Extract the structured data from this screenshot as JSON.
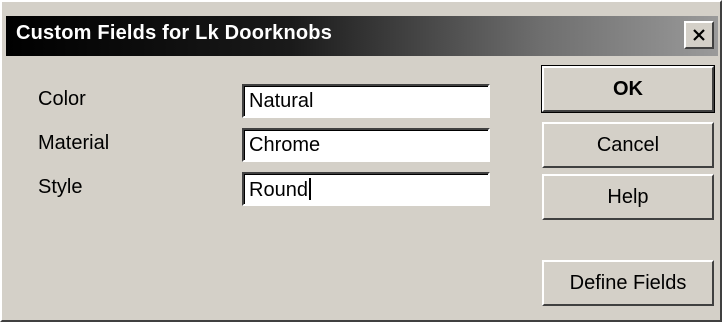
{
  "window": {
    "title": "Custom Fields for Lk Doorknobs",
    "close_glyph": "✕",
    "close_icon": "close-icon"
  },
  "fields": [
    {
      "label": "Color",
      "value": "Natural"
    },
    {
      "label": "Material",
      "value": "Chrome"
    },
    {
      "label": "Style",
      "value": "Round"
    }
  ],
  "buttons": {
    "ok": "OK",
    "cancel": "Cancel",
    "help": "Help",
    "define_fields": "Define Fields"
  },
  "colors": {
    "face": "#d4d0c8",
    "titlebar_start": "#000000",
    "titlebar_end": "#9a9a9a",
    "input_bg": "#ffffff"
  }
}
